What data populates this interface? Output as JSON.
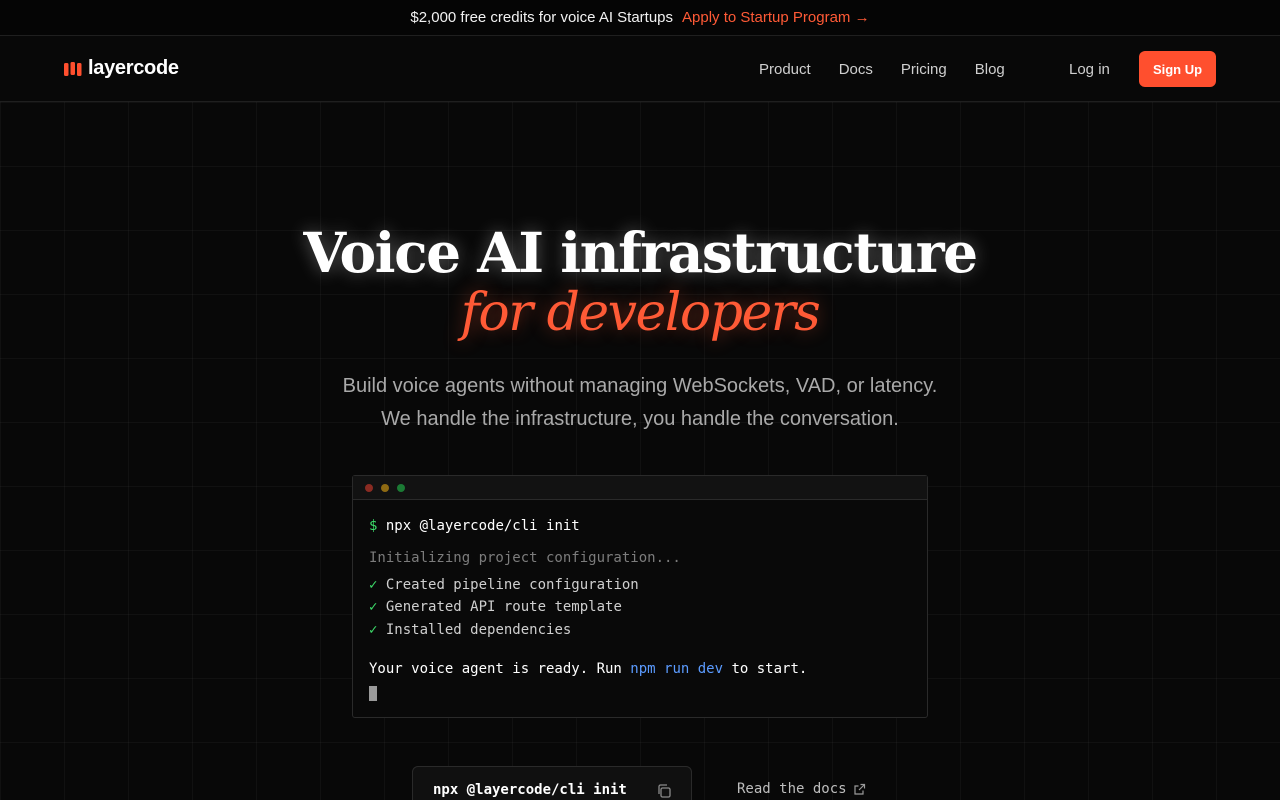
{
  "announcement": {
    "text": "$2,000 free credits for voice AI Startups",
    "link": "Apply to Startup Program →"
  },
  "nav": {
    "logo": "layercode",
    "links": [
      "Product",
      "Docs",
      "Pricing",
      "Blog"
    ],
    "login": "Log in",
    "signup": "Sign Up",
    "accent": "#ff4f2e"
  },
  "hero": {
    "title": "Voice AI infrastructure",
    "subtitle": "for developers",
    "desc_line1": "Build voice agents without managing WebSockets, VAD, or latency.",
    "desc_line2": "We handle the infrastructure, you handle the conversation."
  },
  "terminal": {
    "prompt": "$",
    "command": "npx @layercode/cli init",
    "init": "Initializing project configuration...",
    "checks": [
      "Created pipeline configuration",
      "Generated API route template",
      "Installed dependencies"
    ],
    "check_mark": "✓",
    "ready_before": "Your voice agent is ready. Run ",
    "ready_cmd": "npm run dev",
    "ready_after": " to start."
  },
  "cta": {
    "cli_command": "npx @layercode/cli init",
    "docs_link": "Read the docs"
  }
}
